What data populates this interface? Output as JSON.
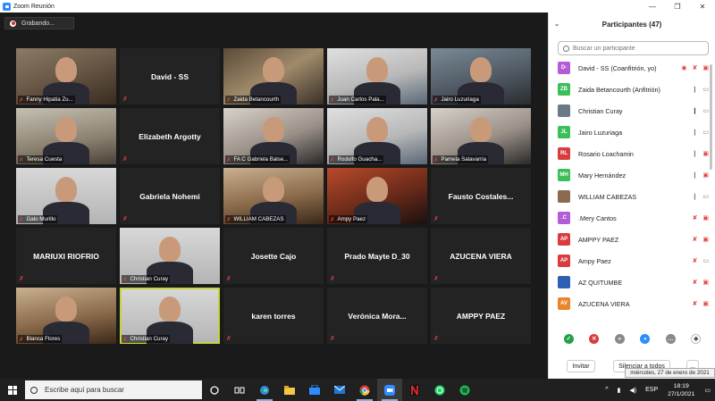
{
  "window": {
    "title": "Zoom Reunión",
    "minimize": "—",
    "maximize": "❐",
    "close": "✕"
  },
  "recording": {
    "label": "Grabando..."
  },
  "tiles": [
    {
      "name": "Fanny Hipatia Zu...",
      "video": true,
      "bg": "v-room1"
    },
    {
      "name": "David - SS",
      "video": false
    },
    {
      "name": "Zaida Betancourth",
      "video": true,
      "bg": "v-room3"
    },
    {
      "name": "Juan Carlos Pala...",
      "video": true,
      "bg": "v-room7"
    },
    {
      "name": "Jairo Luzuriaga",
      "video": true,
      "bg": "v-room8"
    },
    {
      "name": "Teresa Cuesta",
      "video": true,
      "bg": "v-room2"
    },
    {
      "name": "Elizabeth Argotty",
      "video": false
    },
    {
      "name": "FA C Gabriela Balse...",
      "video": true,
      "bg": "v-room4"
    },
    {
      "name": "Rodolfo Guacha...",
      "video": true,
      "bg": "v-room7"
    },
    {
      "name": "Pamela Salavarria",
      "video": true,
      "bg": "v-room4"
    },
    {
      "name": "Galo Murillo",
      "video": true,
      "bg": "v-grey"
    },
    {
      "name": "Gabriela Nohemi",
      "video": false
    },
    {
      "name": "WILLIAM CABEZAS",
      "video": true,
      "bg": "v-room6"
    },
    {
      "name": "Ampy Paez",
      "video": true,
      "bg": "v-room5"
    },
    {
      "name": "Fausto Costales...",
      "video": false
    },
    {
      "name": "MARIUXI RIOFRIO",
      "video": false
    },
    {
      "name": "Christian Curay",
      "video": true,
      "bg": "v-grey"
    },
    {
      "name": "Josette Cajo",
      "video": false
    },
    {
      "name": "Prado Mayte D_30",
      "video": false
    },
    {
      "name": "AZUCENA VIERA",
      "video": false
    },
    {
      "name": "Blanca Flores",
      "video": true,
      "bg": "v-room6"
    },
    {
      "name": "Christian Curay",
      "video": true,
      "bg": "v-grey",
      "active": true
    },
    {
      "name": "karen torres",
      "video": false
    },
    {
      "name": "Verónica Mora...",
      "video": false
    },
    {
      "name": "AMPPY PAEZ",
      "video": false
    }
  ],
  "sidebar": {
    "title": "Participantes (47)",
    "search_placeholder": "Buscar un participante",
    "participants": [
      {
        "initials": "D-",
        "color": "#b45bd6",
        "name": "David - SS (Coanfitrión, yo)",
        "icons": [
          "rec",
          "mic-off",
          "cam-off"
        ]
      },
      {
        "initials": "ZB",
        "color": "#3cbf5a",
        "name": "Zaida Betancourth (Anfitrión)",
        "icons": [
          "mic",
          "cam"
        ]
      },
      {
        "initials": "",
        "color": "#6b7a88",
        "name": "Christian Curay",
        "icons": [
          "mic-on",
          "cam"
        ]
      },
      {
        "initials": "JL",
        "color": "#3cbf5a",
        "name": "Jairo Luzuriaga",
        "icons": [
          "mic",
          "cam"
        ]
      },
      {
        "initials": "RL",
        "color": "#d93c3c",
        "name": "Rosario Loachamin",
        "icons": [
          "mic",
          "cam-off"
        ]
      },
      {
        "initials": "MH",
        "color": "#3cbf5a",
        "name": "Mary Hernández",
        "icons": [
          "mic",
          "cam-off"
        ]
      },
      {
        "initials": "",
        "color": "#8a6a50",
        "name": "WILLIAM CABEZAS",
        "icons": [
          "mic",
          "cam"
        ]
      },
      {
        "initials": ".C",
        "color": "#b45bd6",
        "name": ".Mery Cantos",
        "icons": [
          "mic-off",
          "cam-off"
        ]
      },
      {
        "initials": "AP",
        "color": "#d93c3c",
        "name": "AMPPY PAEZ",
        "icons": [
          "mic-off",
          "cam-off"
        ]
      },
      {
        "initials": "AP",
        "color": "#d93c3c",
        "name": "Ampy Paez",
        "icons": [
          "mic-off",
          "cam"
        ]
      },
      {
        "initials": "",
        "color": "#2d5fb4",
        "name": "AZ QUITUMBE",
        "icons": [
          "mic-off",
          "cam-off"
        ]
      },
      {
        "initials": "AV",
        "color": "#e8872a",
        "name": "AZUCENA VIERA",
        "icons": [
          "mic-off",
          "cam-off"
        ]
      }
    ],
    "invite": "Invitar",
    "mute_all": "Silenciar a todos",
    "more": "..."
  },
  "taskbar": {
    "search_placeholder": "Escribe aquí para buscar",
    "lang": "ESP",
    "time": "18:19",
    "date": "27/1/2021",
    "tooltip": "miércoles, 27 de enero de 2021"
  }
}
